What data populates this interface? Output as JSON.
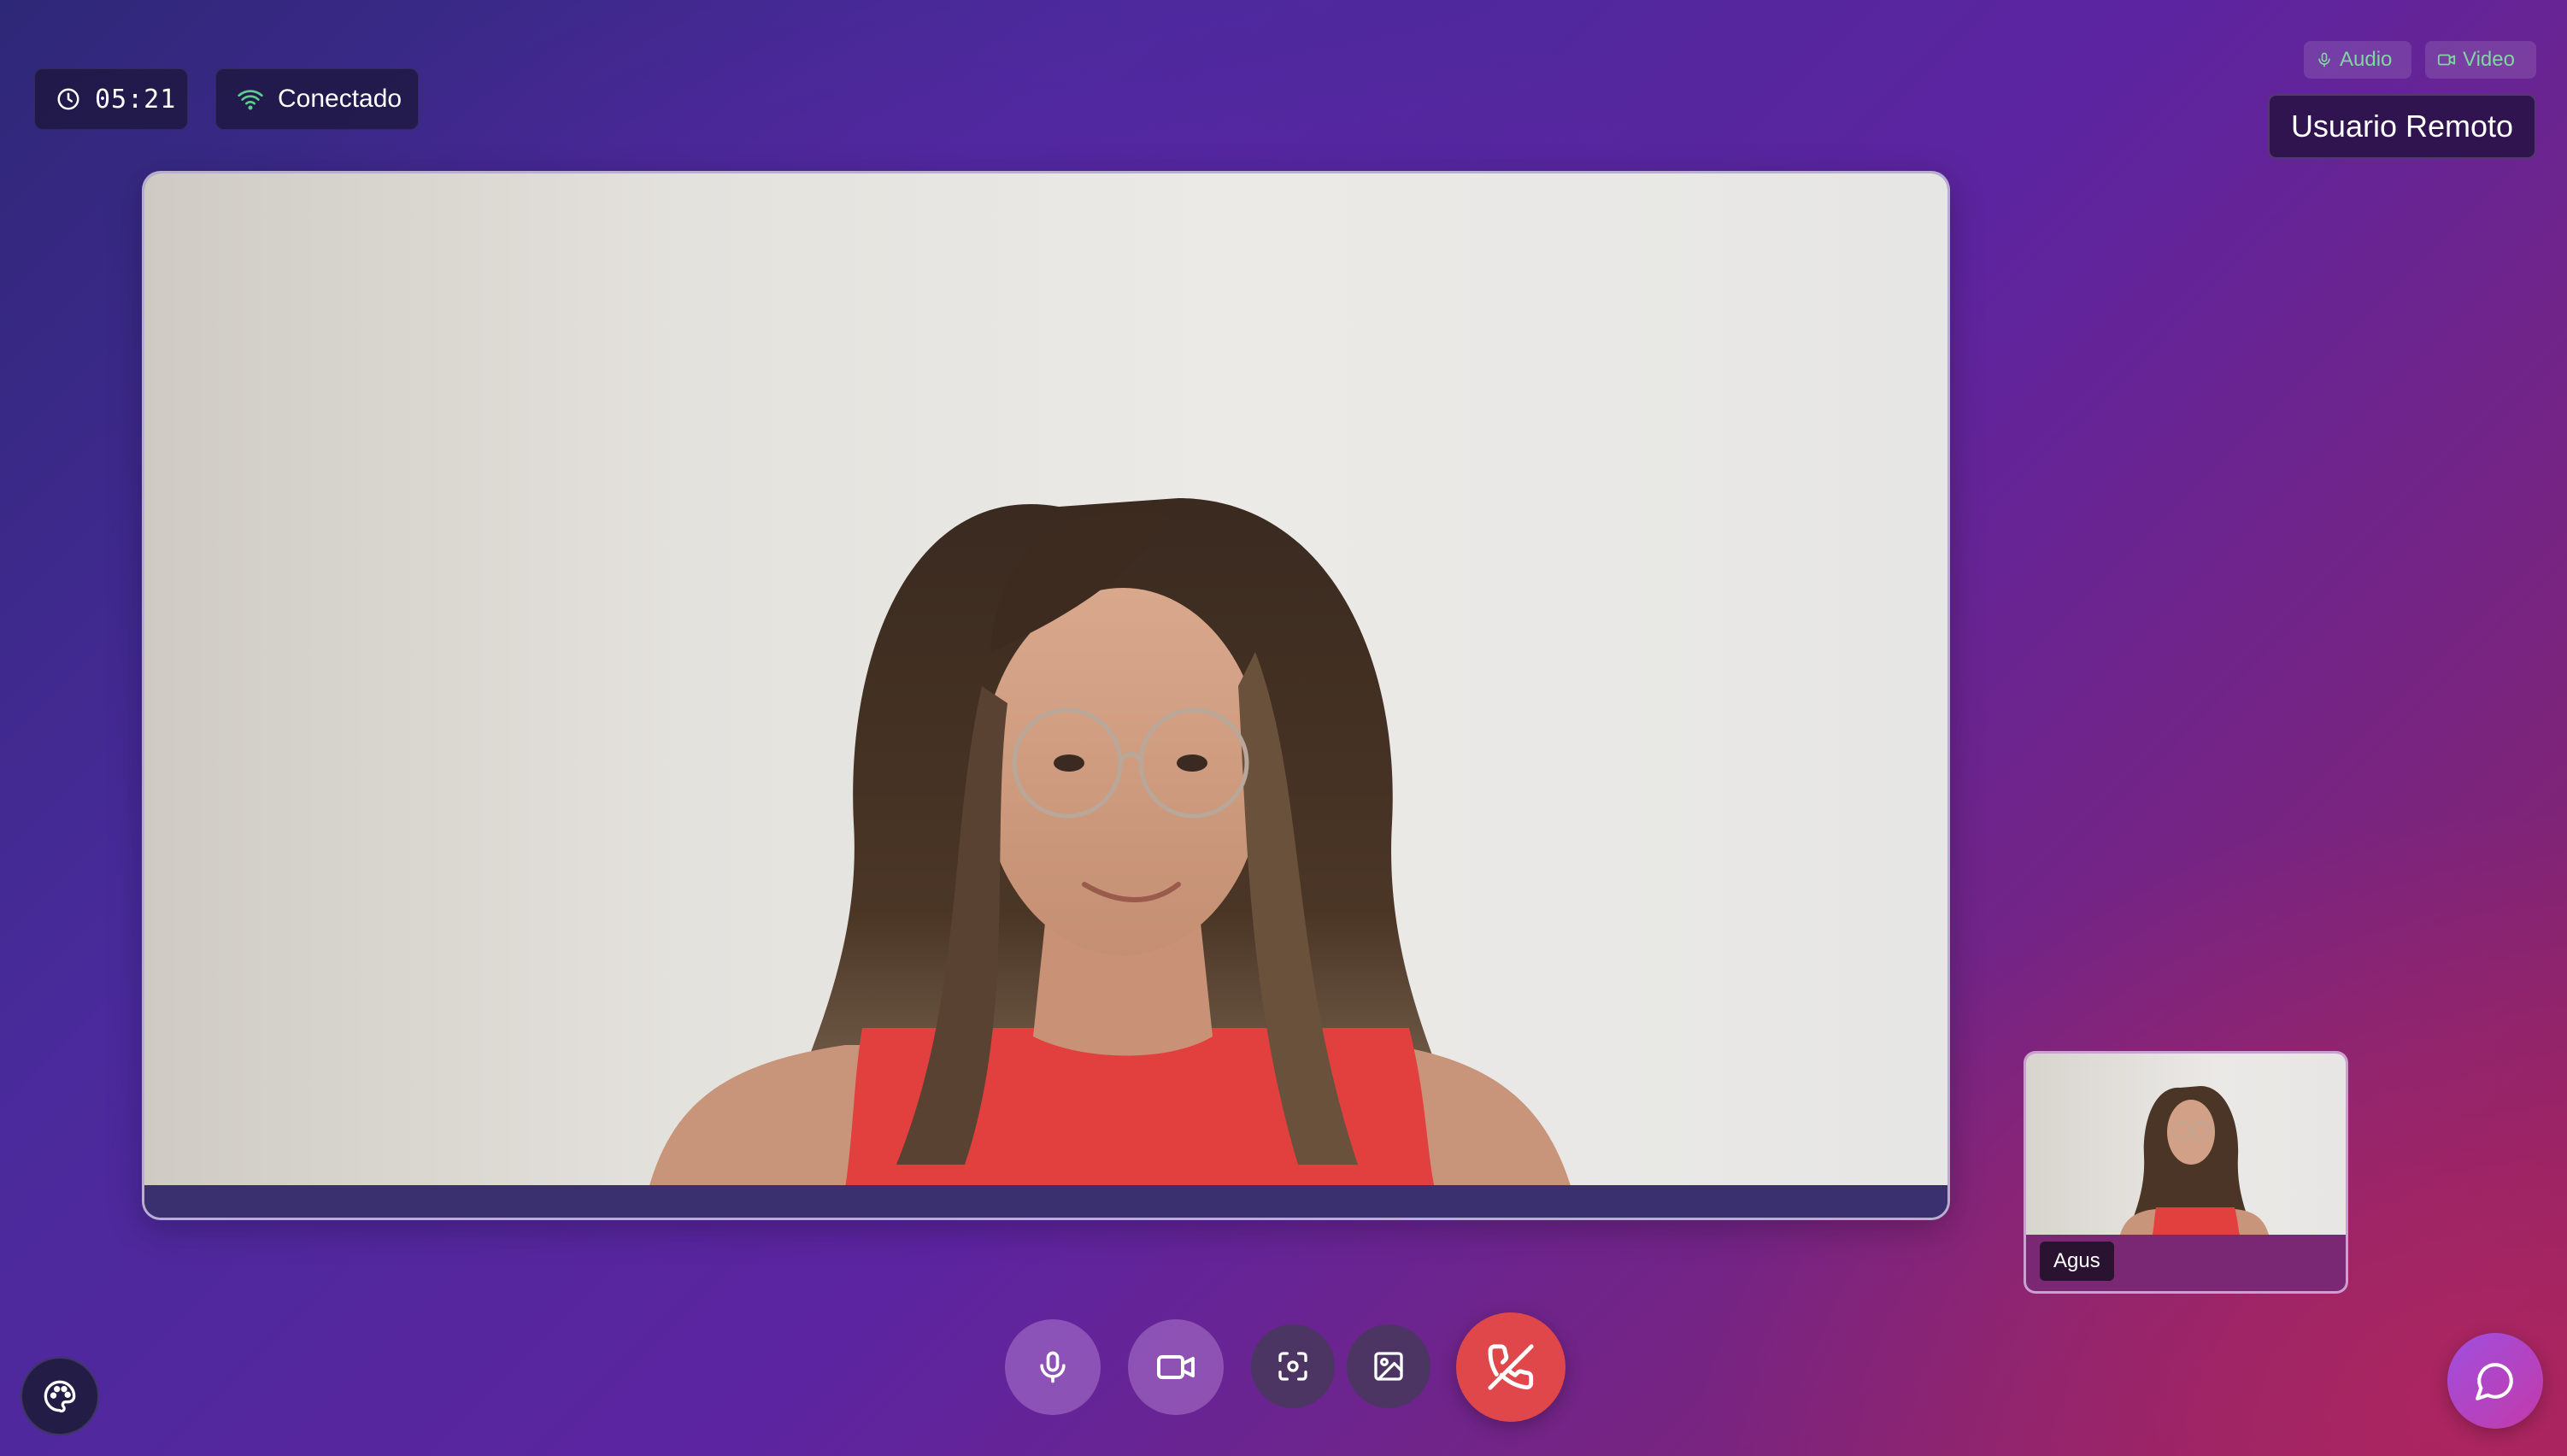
{
  "status": {
    "timer": "05:21",
    "connection": "Conectado",
    "connection_color": "#59d08a"
  },
  "media_badges": {
    "audio": "Audio",
    "video": "Video",
    "color": "#7fd6a0"
  },
  "remote_user": {
    "label": "Usuario Remoto"
  },
  "local_user": {
    "label": "Agus"
  },
  "controls": {
    "mic": "microphone-icon",
    "camera": "video-camera-icon",
    "screenshot": "screenshot-icon",
    "background": "image-icon",
    "hangup": "phone-off-icon",
    "hangup_color": "#e0474b"
  },
  "corner_buttons": {
    "theme": "palette-icon",
    "chat": "message-icon"
  }
}
